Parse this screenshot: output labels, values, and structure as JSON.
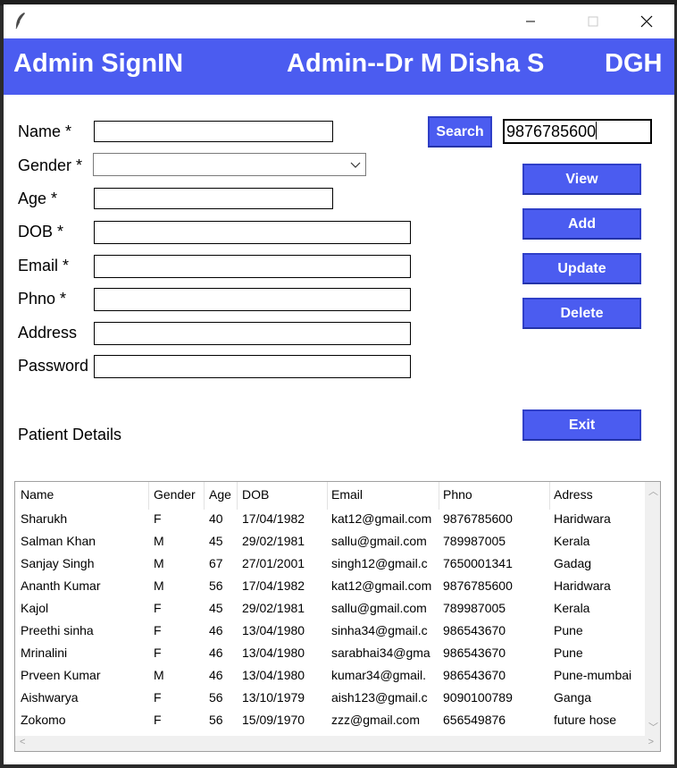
{
  "window": {
    "icon": "feather-icon",
    "controls": {
      "minimize": "minimize-icon",
      "maximize": "maximize-icon",
      "close": "close-icon"
    }
  },
  "header": {
    "title": "Admin SignIN",
    "admin": "Admin--Dr M Disha S",
    "org": "DGH"
  },
  "form": {
    "name_label": "Name *",
    "gender_label": "Gender *",
    "age_label": "Age *",
    "dob_label": "DOB *",
    "email_label": "Email *",
    "phno_label": "Phno *",
    "address_label": "Address",
    "password_label": "Password",
    "name_value": "",
    "gender_value": "",
    "age_value": "",
    "dob_value": "",
    "email_value": "",
    "phno_value": "",
    "address_value": "",
    "password_value": ""
  },
  "search": {
    "button_label": "Search",
    "value": "9876785600"
  },
  "actions": {
    "view": "View",
    "add": "Add",
    "update": "Update",
    "delete": "Delete",
    "exit": "Exit"
  },
  "section_label": "Patient Details",
  "table": {
    "columns": [
      "Name",
      "Gender",
      "Age",
      "DOB",
      "Email",
      "Phno",
      "Adress"
    ],
    "rows": [
      [
        "Sharukh",
        "F",
        "40",
        "17/04/1982",
        "kat12@gmail.com",
        "9876785600",
        "Haridwara"
      ],
      [
        "Salman Khan",
        "M",
        "45",
        "29/02/1981",
        "sallu@gmail.com",
        "789987005",
        "Kerala"
      ],
      [
        "Sanjay Singh",
        "M",
        "67",
        "27/01/2001",
        "singh12@gmail.c",
        "7650001341",
        "Gadag"
      ],
      [
        "Ananth Kumar",
        "M",
        "56",
        "17/04/1982",
        "kat12@gmail.com",
        "9876785600",
        "Haridwara"
      ],
      [
        "Kajol",
        "F",
        "45",
        "29/02/1981",
        "sallu@gmail.com",
        "789987005",
        "Kerala"
      ],
      [
        "Preethi sinha",
        "F",
        "46",
        "13/04/1980",
        "sinha34@gmail.c",
        "986543670",
        "Pune"
      ],
      [
        "Mrinalini",
        "F",
        "46",
        "13/04/1980",
        "sarabhai34@gma",
        "986543670",
        "Pune"
      ],
      [
        "Prveen Kumar",
        "M",
        "46",
        "13/04/1980",
        "kumar34@gmail.",
        "986543670",
        "Pune-mumbai"
      ],
      [
        "Aishwarya",
        "F",
        "56",
        "13/10/1979",
        "aish123@gmail.c",
        "9090100789",
        "Ganga"
      ],
      [
        "Zokomo",
        "F",
        "56",
        "15/09/1970",
        "zzz@gmail.com",
        "656549876",
        "future hose"
      ]
    ]
  },
  "colors": {
    "accent": "#4b5cf0",
    "header_text": "#ffffff",
    "window_bg": "#ffffff"
  }
}
